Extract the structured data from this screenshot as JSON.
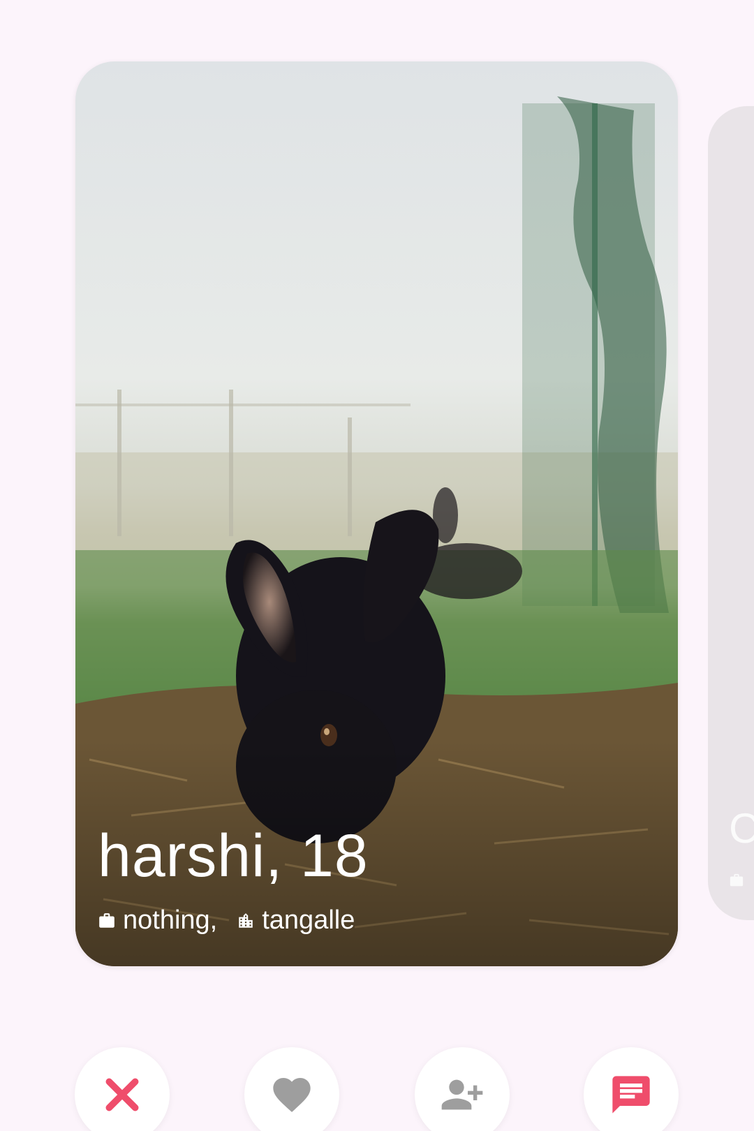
{
  "profile": {
    "name_age": "harshi, 18",
    "occupation": "nothing,",
    "location": "tangalle",
    "occupation_icon": "briefcase-icon",
    "location_icon": "city-icon"
  },
  "next_card": {
    "name_initial": "C",
    "icon": "briefcase-icon"
  },
  "actions": [
    {
      "name": "pass",
      "icon": "close-icon",
      "color": "#ef4d6b"
    },
    {
      "name": "like",
      "icon": "heart-icon",
      "color": "#9e9e9e"
    },
    {
      "name": "follow",
      "icon": "person-add-icon",
      "color": "#9e9e9e"
    },
    {
      "name": "message",
      "icon": "chat-icon",
      "color": "#ef4d6b"
    }
  ],
  "colors": {
    "background": "#fcf4fb",
    "accent": "#ef4d6b",
    "muted_icon": "#9e9e9e"
  }
}
